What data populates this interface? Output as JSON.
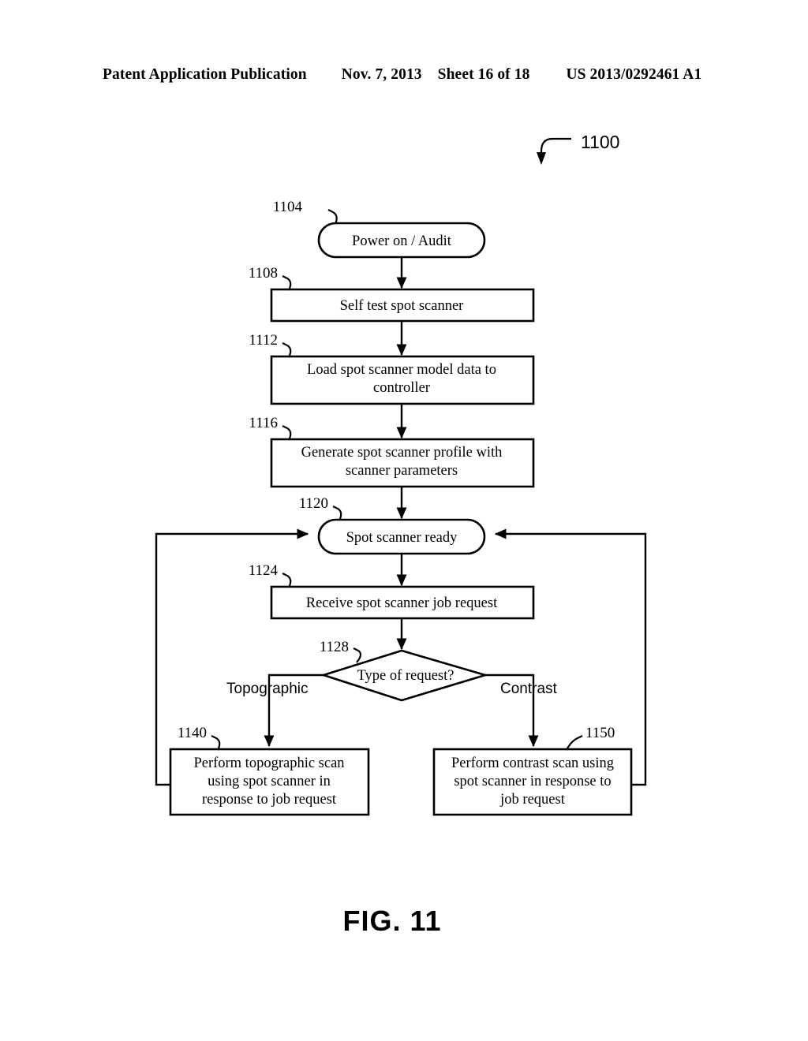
{
  "header": {
    "publication": "Patent Application Publication",
    "date": "Nov. 7, 2013",
    "sheet": "Sheet 16 of 18",
    "patent_number": "US 2013/0292461 A1"
  },
  "figure": {
    "caption": "FIG. 11",
    "diagram_ref": "1100",
    "nodes": [
      {
        "ref": "1104",
        "shape": "stadium",
        "lines": [
          "Power on / Audit"
        ]
      },
      {
        "ref": "1108",
        "shape": "rect",
        "lines": [
          "Self test spot scanner"
        ]
      },
      {
        "ref": "1112",
        "shape": "rect",
        "lines": [
          "Load spot scanner model data to",
          "controller"
        ]
      },
      {
        "ref": "1116",
        "shape": "rect",
        "lines": [
          "Generate spot scanner profile with",
          "scanner parameters"
        ]
      },
      {
        "ref": "1120",
        "shape": "stadium",
        "lines": [
          "Spot scanner ready"
        ]
      },
      {
        "ref": "1124",
        "shape": "rect",
        "lines": [
          "Receive spot scanner job request"
        ]
      },
      {
        "ref": "1128",
        "shape": "diamond",
        "lines": [
          "Type of request?"
        ]
      },
      {
        "ref": "1140",
        "shape": "rect",
        "lines": [
          "Perform topographic scan",
          "using spot scanner in",
          "response to job request"
        ]
      },
      {
        "ref": "1150",
        "shape": "rect",
        "lines": [
          "Perform contrast scan using",
          "spot scanner in response to",
          "job request"
        ]
      }
    ],
    "branch_labels": {
      "left": "Topographic",
      "right": "Contrast"
    }
  }
}
